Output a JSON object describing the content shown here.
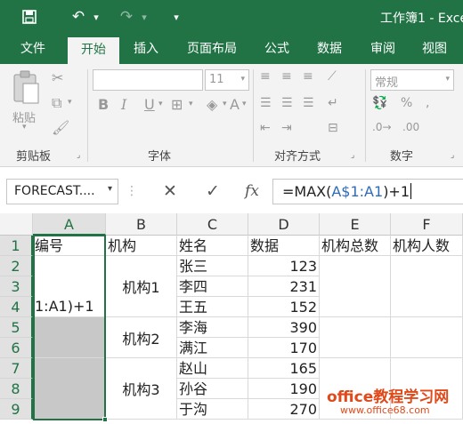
{
  "window": {
    "title": "工作簿1 - Exce"
  },
  "qat": {
    "save": "save-icon",
    "undo": "undo-icon",
    "redo": "redo-icon",
    "customize": "▾"
  },
  "ribbon_tabs": [
    "文件",
    "开始",
    "插入",
    "页面布局",
    "公式",
    "数据",
    "审阅",
    "视图"
  ],
  "active_tab": "开始",
  "ribbon": {
    "paste_label": "粘贴",
    "font_size": "11",
    "number_format": "常规",
    "groups": [
      "剪贴板",
      "字体",
      "对齐方式",
      "数字"
    ],
    "font_buttons": [
      "B",
      "I",
      "U"
    ]
  },
  "formula_bar": {
    "name_box": "FORECAST....",
    "fx": "fx",
    "formula_prefix": "=MAX(",
    "formula_ref": "A$1:A1",
    "formula_suffix": ")+1"
  },
  "columns": [
    "A",
    "B",
    "C",
    "D",
    "E",
    "F"
  ],
  "rows": [
    "1",
    "2",
    "3",
    "4",
    "5",
    "6",
    "7",
    "8",
    "9"
  ],
  "selected_column": "A",
  "sheet": {
    "headers": [
      "编号",
      "机构",
      "姓名",
      "数据",
      "机构总数",
      "机构人数"
    ],
    "a_edit_text": "1:A1)+1",
    "orgs": [
      "机构1",
      "机构2",
      "机构3"
    ],
    "names": [
      "张三",
      "李四",
      "王五",
      "李海",
      "满江",
      "赵山",
      "孙谷",
      "于沟"
    ],
    "values": [
      "123",
      "231",
      "152",
      "390",
      "170",
      "165",
      "190",
      "270"
    ]
  },
  "watermark": {
    "text": "office教程学习网",
    "url": "www.office68.com"
  },
  "colors": {
    "excel_green": "#217346",
    "ref_blue": "#2e6bb8",
    "watermark": "#e04a1a"
  }
}
